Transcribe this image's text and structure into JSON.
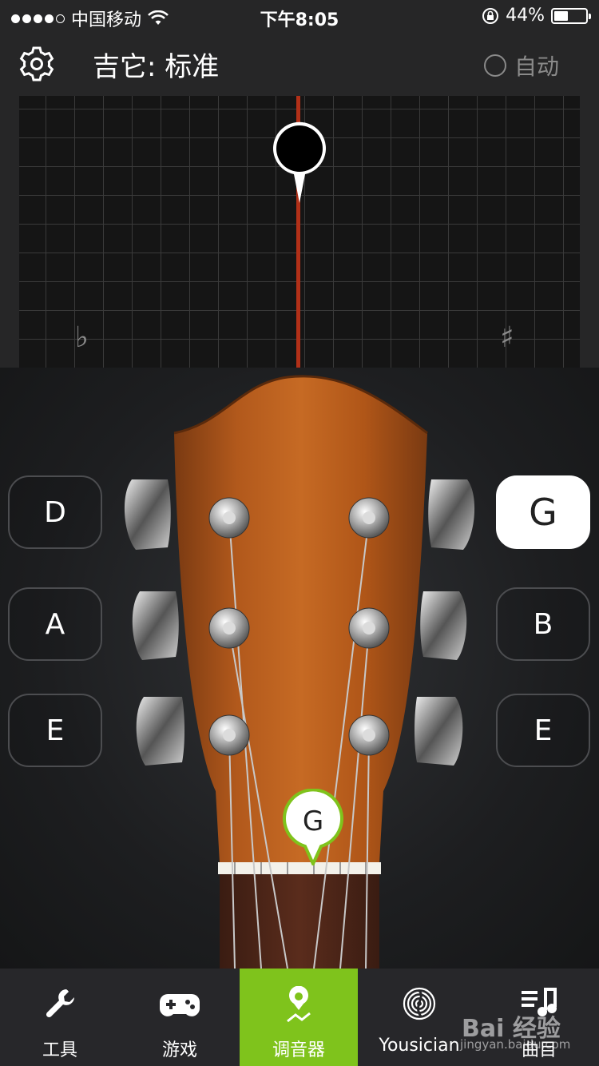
{
  "status": {
    "carrier": "中国移动",
    "time": "下午8:05",
    "battery": "44%",
    "battery_level": 0.44
  },
  "header": {
    "title": "吉它: 标准",
    "auto_label": "自动"
  },
  "meter": {
    "flat_symbol": "♭",
    "sharp_symbol": "♯"
  },
  "strings": {
    "left": [
      "D",
      "A",
      "E"
    ],
    "right": [
      "G",
      "B",
      "E"
    ],
    "active": "G",
    "indicator": "G"
  },
  "tabs": [
    {
      "label": "工具",
      "icon": "wrench-icon"
    },
    {
      "label": "游戏",
      "icon": "gamepad-icon"
    },
    {
      "label": "调音器",
      "icon": "tuner-pin-icon",
      "active": true
    },
    {
      "label": "Yousician",
      "icon": "fingerprint-icon"
    },
    {
      "label": "曲目",
      "icon": "music-list-icon"
    }
  ],
  "watermark": {
    "brand": "Bai 经验",
    "url": "jingyan.baidu.com"
  },
  "colors": {
    "accent": "#7fc31c",
    "needle_line": "#b23018"
  }
}
